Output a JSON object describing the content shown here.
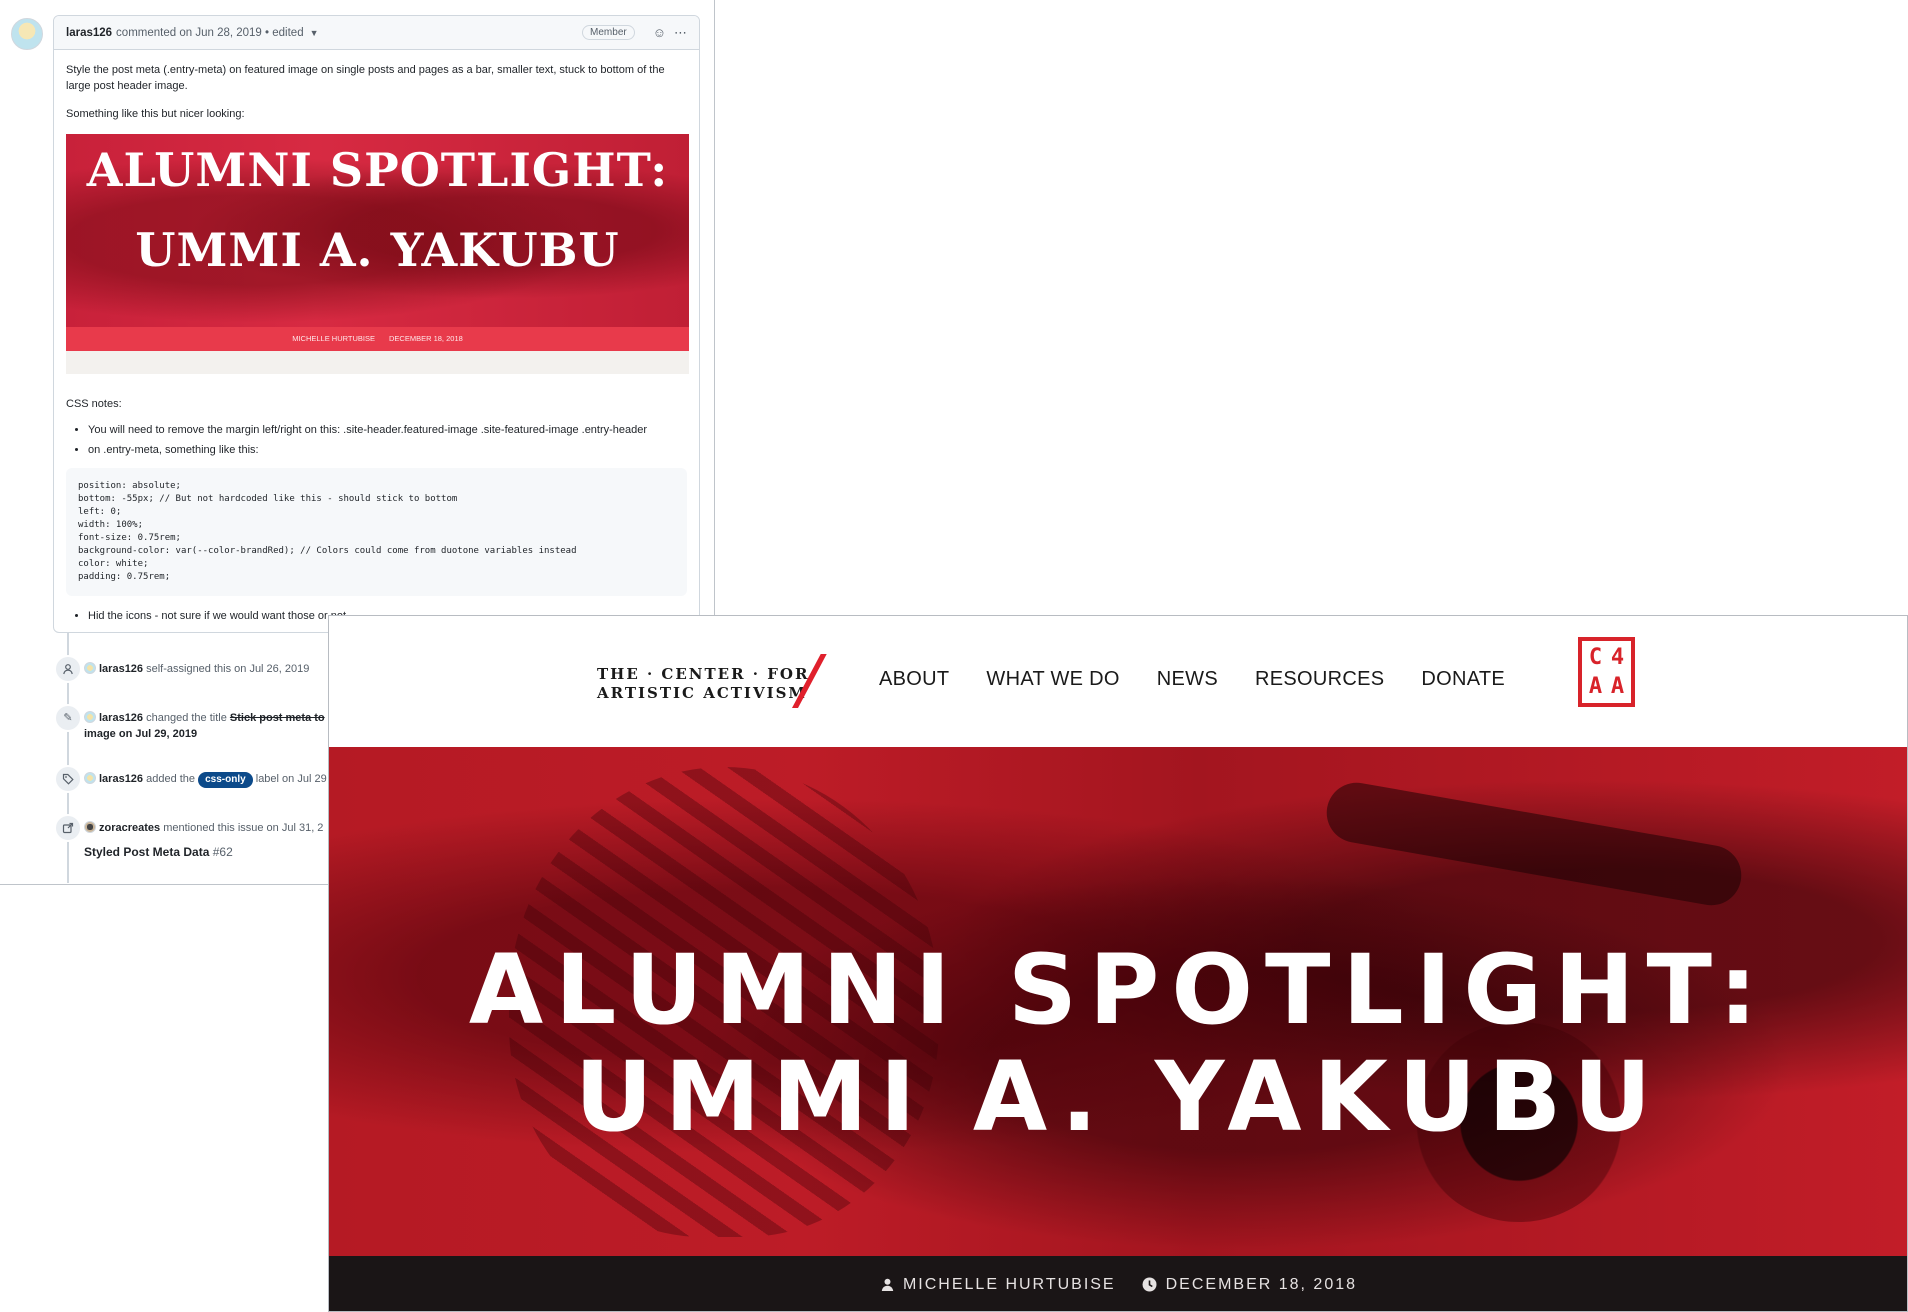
{
  "issue": {
    "comment": {
      "author": "laras126",
      "action": "commented on",
      "date": "Jun 28, 2019",
      "edited": "• edited",
      "badge": "Member",
      "paragraph1": "Style the post meta (.entry-meta) on featured image on single posts and pages as a bar, smaller text, stuck to bottom of the large post header image.",
      "paragraph2": "Something like this but nicer looking:",
      "mockup": {
        "line1": "ALUMNI SPOTLIGHT:",
        "line2": "UMMI A. YAKUBU",
        "author": "MICHELLE HURTUBISE",
        "date": "DECEMBER 18, 2018"
      },
      "css_notes_label": "CSS notes:",
      "bullet1": "You will need to remove the margin left/right on this: .site-header.featured-image .site-featured-image .entry-header",
      "bullet2": "on .entry-meta, something like this:",
      "code": "position: absolute;\nbottom: -55px; // But not hardcoded like this - should stick to bottom\nleft: 0;\nwidth: 100%;\nfont-size: 0.75rem;\nbackground-color: var(--color-brandRed); // Colors could come from duotone variables instead\ncolor: white;\npadding: 0.75rem;",
      "bullet3": "Hid the icons - not sure if we would want those or not"
    },
    "events": [
      {
        "icon": "person-icon",
        "user": "laras126",
        "text": "self-assigned this on Jul 26, 2019"
      },
      {
        "icon": "pencil-icon",
        "user": "laras126",
        "text_before": "changed the title",
        "old_title": "Stick post meta to",
        "line2": "image on Jul 29, 2019"
      },
      {
        "icon": "tag-icon",
        "user": "laras126",
        "text_before": "added the",
        "label": "css-only",
        "text_after": "label on Jul 29"
      },
      {
        "icon": "cross-reference-icon",
        "user": "zoracreates",
        "text": "mentioned this issue on Jul 31, 2"
      }
    ],
    "reference": {
      "title": "Styled Post Meta Data",
      "number": "#62"
    }
  },
  "site": {
    "logo_line1": "THE · CENTER · FOR",
    "logo_line2": "ARTISTIC ACTIVISM",
    "nav": [
      "ABOUT",
      "WHAT WE DO",
      "NEWS",
      "RESOURCES",
      "DONATE"
    ],
    "badge_letters": [
      "C",
      "4",
      "A",
      "A"
    ],
    "hero_line1": "ALUMNI SPOTLIGHT:",
    "hero_line2": "UMMI A. YAKUBU",
    "meta_author": "MICHELLE HURTUBISE",
    "meta_date": "DECEMBER 18, 2018",
    "colors": {
      "brand_red": "#d8232a",
      "meta_bar": "#1a1516"
    }
  }
}
